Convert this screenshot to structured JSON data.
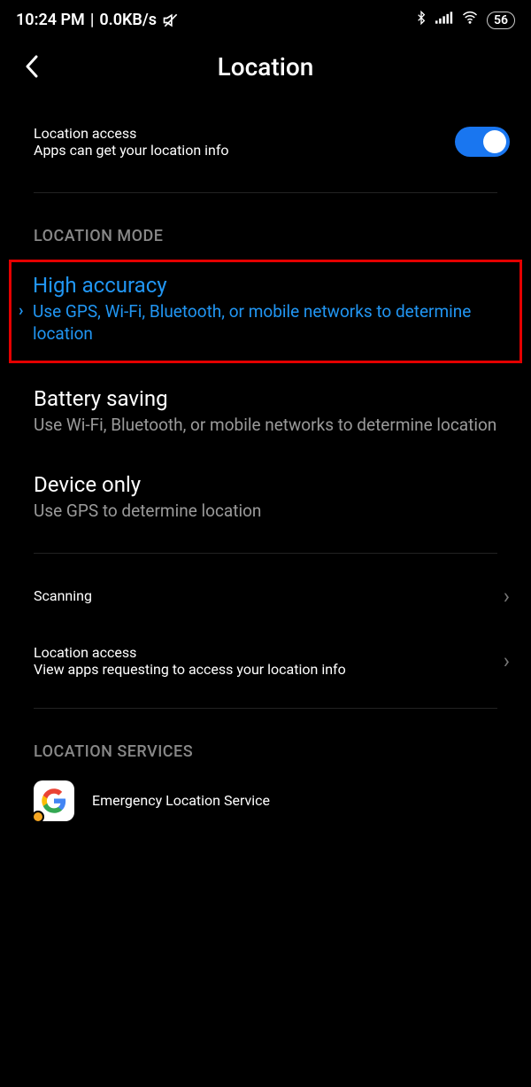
{
  "status": {
    "time": "10:24 PM",
    "speed": "0.0KB/s",
    "battery": "56"
  },
  "header": {
    "title": "Location"
  },
  "location_access": {
    "title": "Location access",
    "sub": "Apps can get your location info",
    "enabled": true
  },
  "sections": {
    "mode": "LOCATION MODE",
    "services": "LOCATION SERVICES"
  },
  "modes": {
    "high": {
      "title": "High accuracy",
      "sub": "Use GPS, Wi-Fi, Bluetooth, or mobile networks to determine location"
    },
    "battery": {
      "title": "Battery saving",
      "sub": "Use Wi-Fi, Bluetooth, or mobile networks to determine location"
    },
    "device": {
      "title": "Device only",
      "sub": "Use GPS to determine location"
    }
  },
  "scanning": {
    "title": "Scanning"
  },
  "app_access": {
    "title": "Location access",
    "sub": "View apps requesting to access your location info"
  },
  "service": {
    "title": "Emergency Location Service"
  }
}
